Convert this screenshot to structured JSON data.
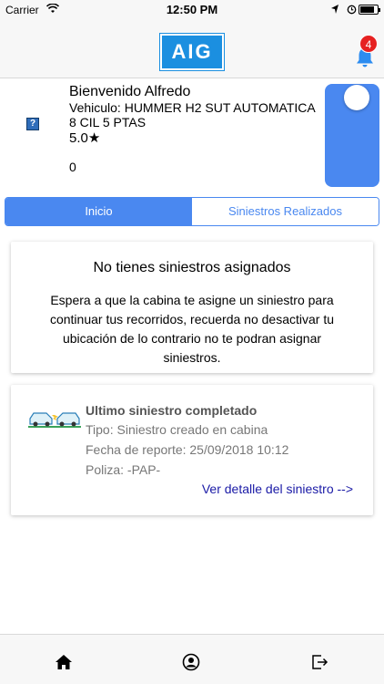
{
  "status_bar": {
    "carrier": "Carrier",
    "time": "12:50 PM"
  },
  "header": {
    "logo_text": "AIG",
    "notifications_count": "4",
    "brand_color": "#1b8fe0"
  },
  "profile": {
    "welcome": "Bienvenido Alfredo",
    "vehicle_line1": "Vehiculo: HUMMER H2 SUT AUTOMATICA",
    "vehicle_line2": "8 CIL 5 PTAS",
    "rating": "5.0★",
    "count": "0",
    "avatar_placeholder": "?"
  },
  "tabs": {
    "inicio": "Inicio",
    "siniestros": "Siniestros Realizados",
    "accent": "#4a88f0"
  },
  "empty_card": {
    "title": "No tienes siniestros asignados",
    "body": "Espera a que la cabina te asigne un siniestro para continuar tus recorridos, recuerda no desactivar tu ubicación de lo contrario no te podran asignar siniestros."
  },
  "last_card": {
    "title": "Ultimo siniestro completado",
    "tipo": "Tipo: Siniestro creado en cabina",
    "fecha": "Fecha de reporte: 25/09/2018 10:12",
    "poliza": "Poliza: -PAP-",
    "link": "Ver detalle del siniestro -->"
  },
  "tab_bar": {
    "icons": [
      "home-icon",
      "profile-icon",
      "logout-icon"
    ]
  }
}
